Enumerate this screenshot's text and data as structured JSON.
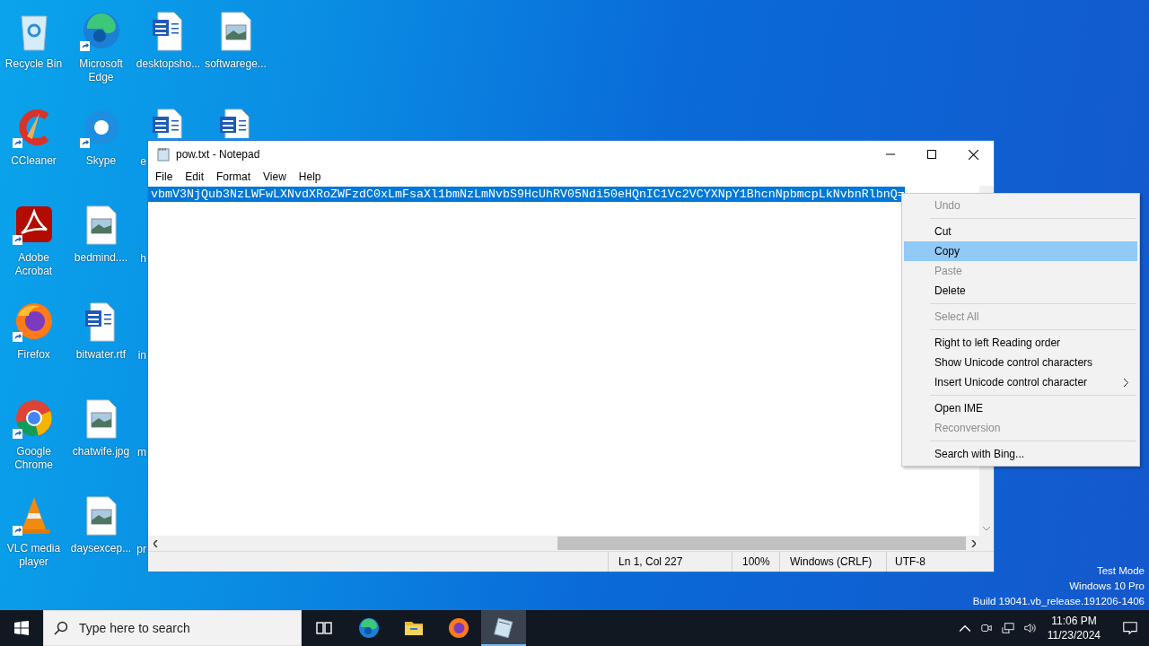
{
  "desktop": {
    "columns": [
      {
        "items": [
          {
            "label": "Recycle Bin",
            "kind": "full",
            "shortcut": false
          },
          {
            "label": "CCleaner",
            "kind": "full",
            "shortcut": true
          },
          {
            "label": "Adobe Acrobat",
            "kind": "full",
            "shortcut": true
          },
          {
            "label": "Firefox",
            "kind": "full",
            "shortcut": true
          },
          {
            "label": "Google Chrome",
            "kind": "full",
            "shortcut": true
          },
          {
            "label": "VLC media player",
            "kind": "full",
            "shortcut": true
          }
        ]
      },
      {
        "items": [
          {
            "label": "Microsoft Edge",
            "kind": "full",
            "shortcut": true
          },
          {
            "label": "Skype",
            "kind": "full",
            "shortcut": true
          },
          {
            "label": "bedmind....",
            "kind": "full",
            "shortcut": false
          },
          {
            "label": "bitwater.rtf",
            "kind": "full",
            "shortcut": false
          },
          {
            "label": "chatwife.jpg",
            "kind": "full",
            "shortcut": false
          },
          {
            "label": "daysexcep...",
            "kind": "full",
            "shortcut": false
          }
        ]
      },
      {
        "items": [
          {
            "label": "desktopsho...",
            "kind": "full",
            "shortcut": false
          },
          {
            "label": "e",
            "kind": "clipped",
            "shortcut": false
          },
          {
            "label": "h",
            "kind": "label_only"
          },
          {
            "label": "in",
            "kind": "label_only"
          },
          {
            "label": "m",
            "kind": "label_only"
          },
          {
            "label": "pr",
            "kind": "label_only"
          }
        ]
      },
      {
        "items": [
          {
            "label": "softwarege...",
            "kind": "full",
            "shortcut": false
          },
          {
            "kind": "icon_only",
            "shortcut": false
          }
        ]
      }
    ]
  },
  "system_text": [
    "Test Mode",
    "Windows 10 Pro",
    "Build 19041.vb_release.191206-1406"
  ],
  "notepad": {
    "title": "pow.txt - Notepad",
    "menu": [
      "File",
      "Edit",
      "Format",
      "View",
      "Help"
    ],
    "text": "vbmV3NjQub3NzLWFwLXNvdXRoZWFzdC0xLmFsaXl1bmNzLmNvbS9HcUhRV05Ndi50eHQnIC1Vc2VCYXNpY1BhcnNpbmcpLkNvbnRlbnQ=",
    "status_bar": [
      "Ln 1, Col 227",
      "100%",
      "Windows (CRLF)",
      "UTF-8"
    ]
  },
  "context_menu": [
    {
      "kind": "item",
      "label": "Undo",
      "disabled": true,
      "selected": false,
      "submenu": false
    },
    {
      "kind": "separator"
    },
    {
      "kind": "item",
      "label": "Cut",
      "disabled": false,
      "selected": false,
      "submenu": false
    },
    {
      "kind": "item",
      "label": "Copy",
      "disabled": false,
      "selected": true,
      "submenu": false
    },
    {
      "kind": "item",
      "label": "Paste",
      "disabled": true,
      "selected": false,
      "submenu": false
    },
    {
      "kind": "item",
      "label": "Delete",
      "disabled": false,
      "selected": false,
      "submenu": false
    },
    {
      "kind": "separator"
    },
    {
      "kind": "item",
      "label": "Select All",
      "disabled": true,
      "selected": false,
      "submenu": false
    },
    {
      "kind": "separator"
    },
    {
      "kind": "item",
      "label": "Right to left Reading order",
      "disabled": false,
      "selected": false,
      "submenu": false
    },
    {
      "kind": "item",
      "label": "Show Unicode control characters",
      "disabled": false,
      "selected": false,
      "submenu": false
    },
    {
      "kind": "item",
      "label": "Insert Unicode control character",
      "disabled": false,
      "selected": false,
      "submenu": true
    },
    {
      "kind": "separator"
    },
    {
      "kind": "item",
      "label": "Open IME",
      "disabled": false,
      "selected": false,
      "submenu": false
    },
    {
      "kind": "item",
      "label": "Reconversion",
      "disabled": true,
      "selected": false,
      "submenu": false
    },
    {
      "kind": "separator"
    },
    {
      "kind": "item",
      "label": "Search with Bing...",
      "disabled": false,
      "selected": false,
      "submenu": false
    }
  ],
  "taskbar": {
    "search": {
      "placeholder": "Type here to search"
    },
    "apps": [
      {
        "selected": false
      },
      {
        "selected": false
      },
      {
        "selected": false
      },
      {
        "selected": false
      },
      {
        "selected": true
      }
    ],
    "time": "11:06 PM",
    "date": "11/23/2024"
  }
}
